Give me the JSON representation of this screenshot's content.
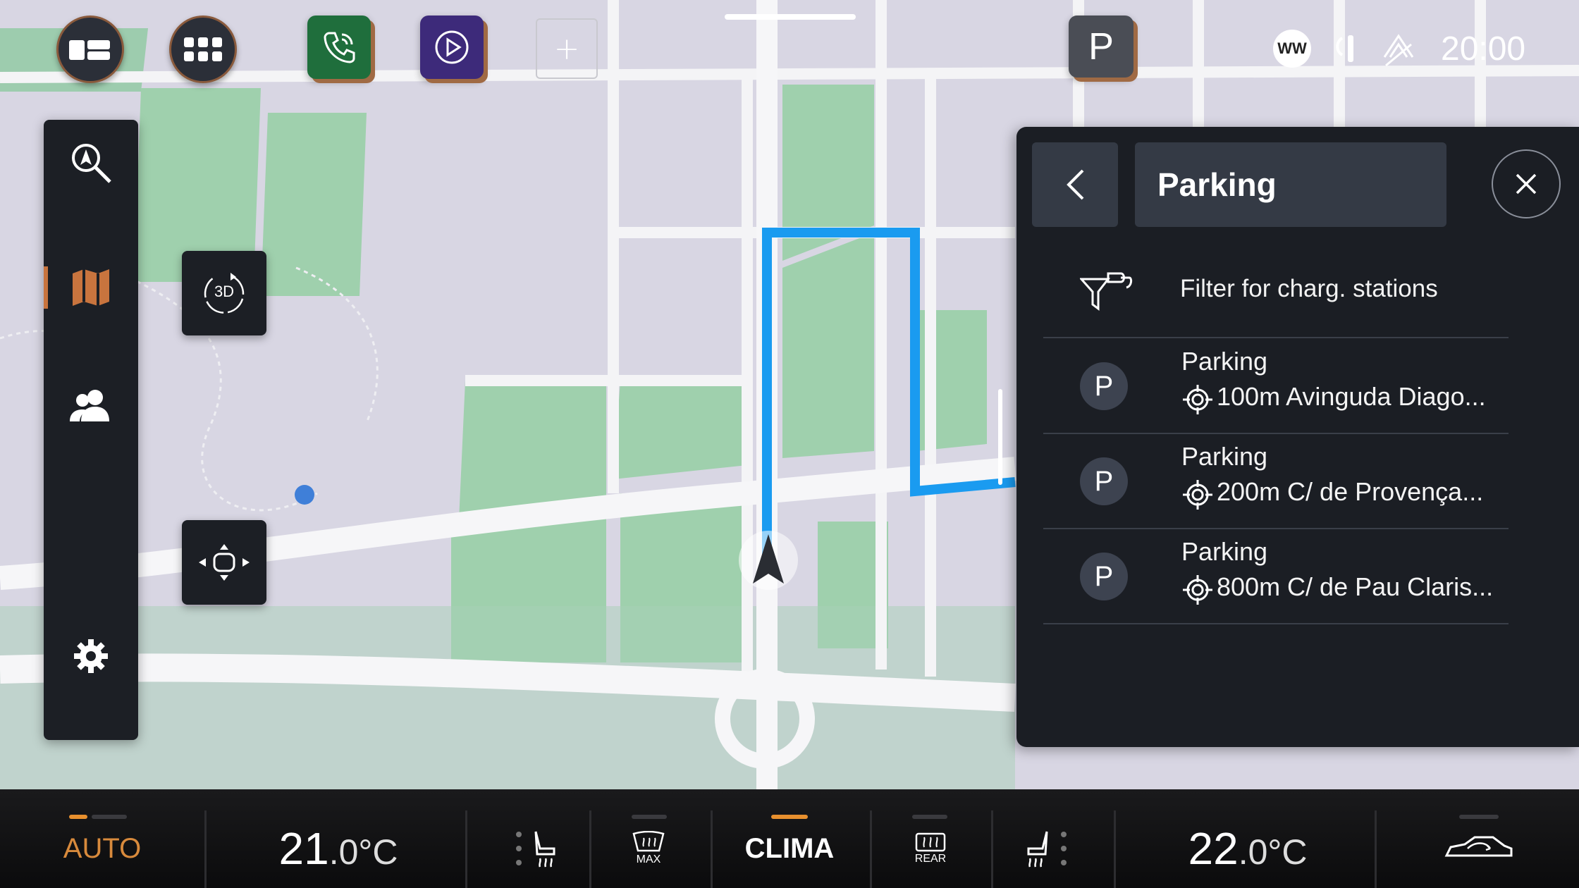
{
  "top_bar": {
    "left_buttons": [
      {
        "icon": "home-layout-icon"
      },
      {
        "icon": "apps-grid-icon"
      }
    ],
    "shortcuts": [
      {
        "icon": "phone-icon",
        "color": "#1f6e3c"
      },
      {
        "icon": "media-play-icon",
        "color": "#3d2a7a"
      }
    ],
    "add_label": "+",
    "parking_shortcut_label": "P",
    "status": {
      "ww_label": "WW",
      "time": "20:00",
      "icons": [
        "wireless-charging-icon",
        "connectivity-icon"
      ]
    }
  },
  "sidebar": {
    "items": [
      {
        "icon": "search-location-icon"
      },
      {
        "icon": "map-icon",
        "active": true
      },
      {
        "icon": "contacts-icon"
      },
      {
        "icon": "settings-icon"
      }
    ],
    "accent_color": "#c8743e"
  },
  "map_controls": {
    "view_mode_label": "3D",
    "center_icon": "car-center-icon"
  },
  "route_color": "#1a9bf0",
  "panel": {
    "title": "Parking",
    "filter_label": "Filter for charg. stations",
    "results": [
      {
        "badge": "P",
        "name": "Parking",
        "distance": "100m Avinguda Diago..."
      },
      {
        "badge": "P",
        "name": "Parking",
        "distance": "200m C/ de Provença..."
      },
      {
        "badge": "P",
        "name": "Parking",
        "distance": "800m C/ de Pau Claris..."
      }
    ]
  },
  "clima": {
    "auto_label": "AUTO",
    "left_temp_int": "21",
    "left_temp_dec": ".0",
    "unit": "°C",
    "max_label": "MAX",
    "center_label": "CLIMA",
    "rear_label": "REAR",
    "right_temp_int": "22",
    "right_temp_dec": ".0",
    "accent_color": "#e8902e"
  }
}
